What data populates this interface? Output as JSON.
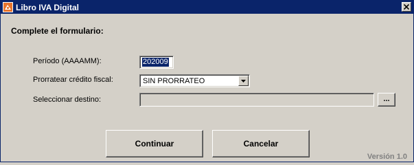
{
  "window": {
    "title": "Libro IVA Digital",
    "icon": "app-logo-icon",
    "close_icon": "close-icon"
  },
  "form": {
    "heading": "Complete el formulario:",
    "periodo_label": "Período (AAAAMM):",
    "periodo_value": "202009",
    "prorratear_label": "Prorratear crédito fiscal:",
    "prorratear_value": "SIN PRORRATEO",
    "destino_label": "Seleccionar destino:",
    "destino_value": "",
    "browse_label": "..."
  },
  "actions": {
    "continuar": "Continuar",
    "cancelar": "Cancelar"
  },
  "footer": {
    "version": "Versión 1.0"
  },
  "colors": {
    "titlebar": "#0a246a",
    "background": "#d4d0c8",
    "selection": "#0a246a",
    "version_text": "#808080"
  }
}
